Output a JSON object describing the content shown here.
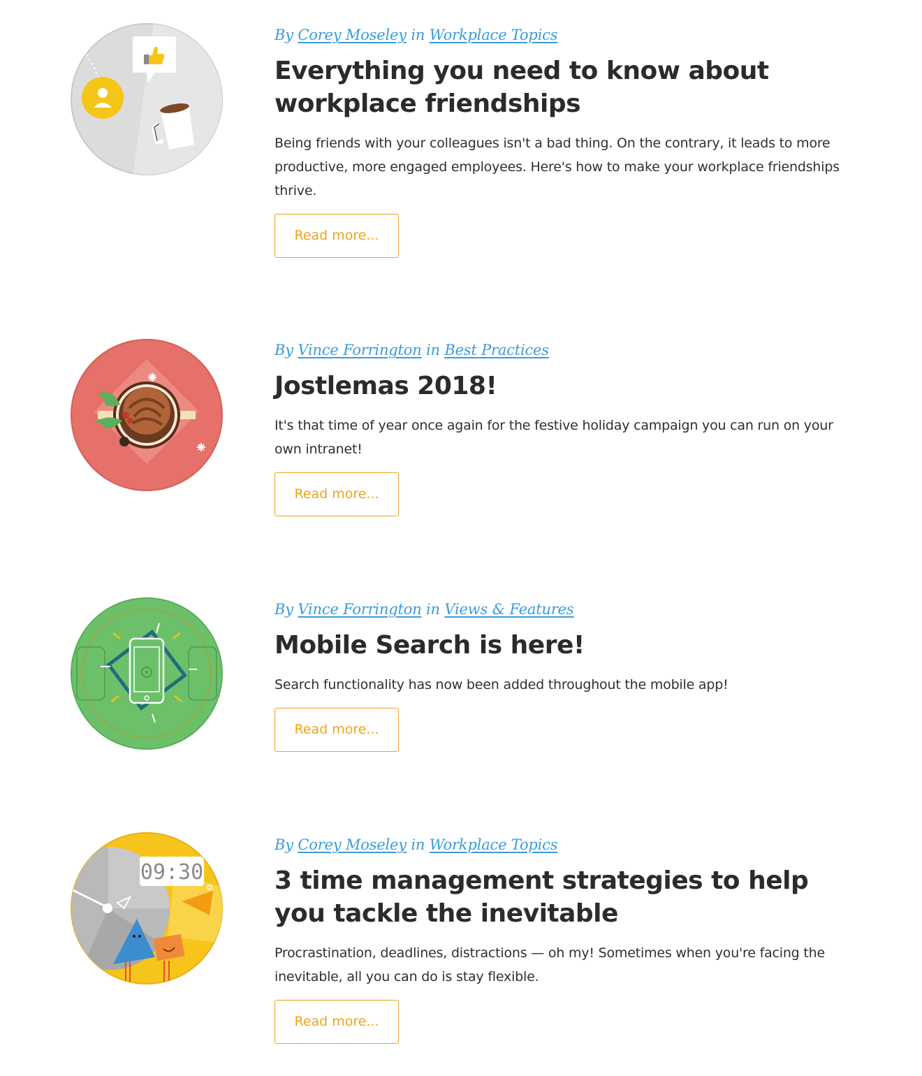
{
  "posts": [
    {
      "by": "By",
      "author": "Corey Moseley",
      "in": "in",
      "category": "Workplace Topics",
      "title": "Everything you need to know about workplace friendships",
      "excerpt": "Being friends with your colleagues isn't a bad thing. On the contrary, it leads to more productive, more engaged employees. Here's how to make your workplace friendships thrive.",
      "button": "Read more...",
      "image_icon": "friendship-coffee-icon"
    },
    {
      "by": "By",
      "author": "Vince Forrington",
      "in": "in",
      "category": "Best Practices",
      "title": "Jostlemas 2018!",
      "excerpt": "It's that time of year once again for the festive holiday campaign you can run on your own intranet!",
      "button": "Read more...",
      "image_icon": "holiday-pudding-icon"
    },
    {
      "by": "By",
      "author": "Vince Forrington",
      "in": "in",
      "category": "Views & Features",
      "title": "Mobile Search is here!",
      "excerpt": "Search functionality has now been added throughout the mobile app!",
      "button": "Read more...",
      "image_icon": "mobile-phone-icon"
    },
    {
      "by": "By",
      "author": "Corey Moseley",
      "in": "in",
      "category": "Workplace Topics",
      "title": "3 time management strategies to help you tackle the inevitable",
      "excerpt": "Procrastination, deadlines, distractions — oh my! Sometimes when you're facing the inevitable, all you can do is stay flexible.",
      "button": "Read more...",
      "image_icon": "clock-time-icon",
      "image_clock_text": "09:30"
    }
  ],
  "colors": {
    "link": "#3a9bd9",
    "button": "#f0a21c",
    "text": "#2b2b2b"
  }
}
